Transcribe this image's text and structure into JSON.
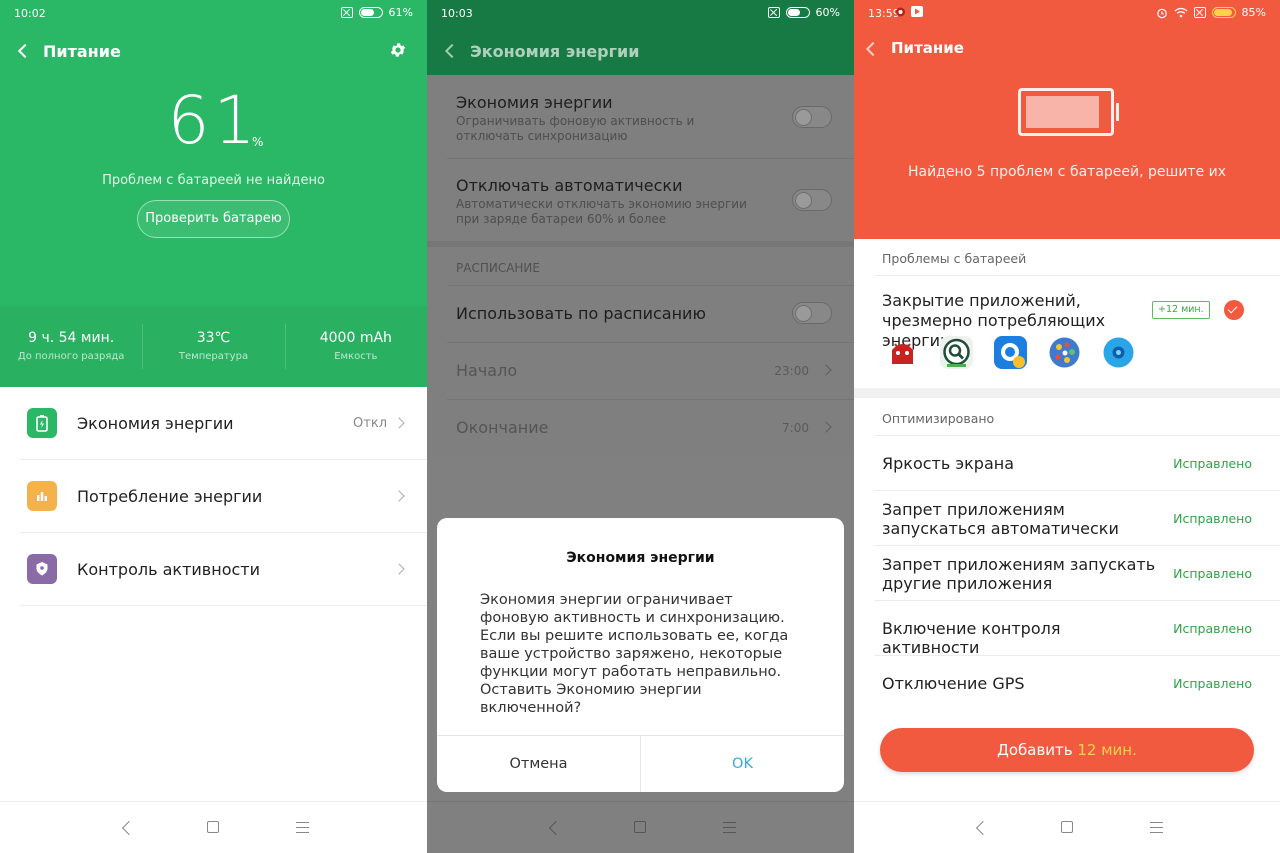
{
  "panel1": {
    "status": {
      "time": "10:02",
      "battery": "61%",
      "battery_level": 0.61
    },
    "header": {
      "title": "Питание"
    },
    "percent": "61",
    "percent_sign": "%",
    "no_problems": "Проблем с батареей не найдено",
    "check_button": "Проверить батарею",
    "stats": [
      {
        "value": "9 ч. 54 мин.",
        "label": "До полного разряда"
      },
      {
        "value": "33℃",
        "label": "Температура"
      },
      {
        "value": "4000 mAh",
        "label": "Емкость"
      }
    ],
    "menu": [
      {
        "label": "Экономия энергии",
        "value": "Откл",
        "icon": "battery-saver-icon",
        "color": "#2bb866"
      },
      {
        "label": "Потребление энергии",
        "value": "",
        "icon": "bar-chart-icon",
        "color": "#f6b24a"
      },
      {
        "label": "Контроль активности",
        "value": "",
        "icon": "shield-icon",
        "color": "#8b6aa8"
      }
    ]
  },
  "panel2": {
    "status": {
      "time": "10:03",
      "battery": "60%",
      "battery_level": 0.6
    },
    "header": {
      "title": "Экономия энергии"
    },
    "rows": [
      {
        "title": "Экономия энергии",
        "subtitle": "Ограничивать фоновую активность и отключать синхронизацию"
      },
      {
        "title": "Отключать автоматически",
        "subtitle": "Автоматически отключать экономию энергии при заряде батареи 60% и более"
      }
    ],
    "schedule_section": "РАСПИСАНИЕ",
    "schedule_row": "Использовать по расписанию",
    "start": {
      "label": "Начало",
      "value": "23:00"
    },
    "end": {
      "label": "Окончание",
      "value": "7:00"
    },
    "dialog": {
      "title": "Экономия энергии",
      "body": "Экономия энергии ограничивает фоновую активность и синхронизацию. Если вы решите использовать ее, когда ваше устройство заряжено, некоторые функции могут работать неправильно. Оставить Экономию энергии включенной?",
      "cancel": "Отмена",
      "ok": "OK",
      "ok_color": "#3aa7e0"
    }
  },
  "panel3": {
    "status": {
      "time": "13:59",
      "battery": "85%",
      "battery_level": 0.85
    },
    "header": {
      "title": "Питание"
    },
    "found_text": "Найдено 5 проблем с батареей, решите их",
    "problems_section": "Проблемы с батареей",
    "problem": {
      "title": "Закрытие приложений, чрезмерно потребляющих энергию",
      "badge": "+12 мин."
    },
    "apps": [
      "antutu-app-icon",
      "speedtest-app-icon",
      "camera-app-icon",
      "dots-app-icon",
      "blue-app-icon"
    ],
    "optimized_section": "Оптимизировано",
    "optimized": [
      {
        "title": "Яркость экрана",
        "status": "Исправлено"
      },
      {
        "title": "Запрет приложениям запускаться автоматически",
        "status": "Исправлено"
      },
      {
        "title": "Запрет приложениям запускать другие приложения",
        "status": "Исправлено"
      },
      {
        "title": "Включение контроля активности",
        "status": "Исправлено"
      },
      {
        "title": "Отключение GPS",
        "status": "Исправлено"
      }
    ],
    "add_button": {
      "prefix": "Добавить ",
      "highlight": "12 мин."
    }
  },
  "colors": {
    "green": "#2bb866",
    "dark_green": "#177a44",
    "orange": "#f25a40",
    "fixed_green": "#2ea447"
  }
}
